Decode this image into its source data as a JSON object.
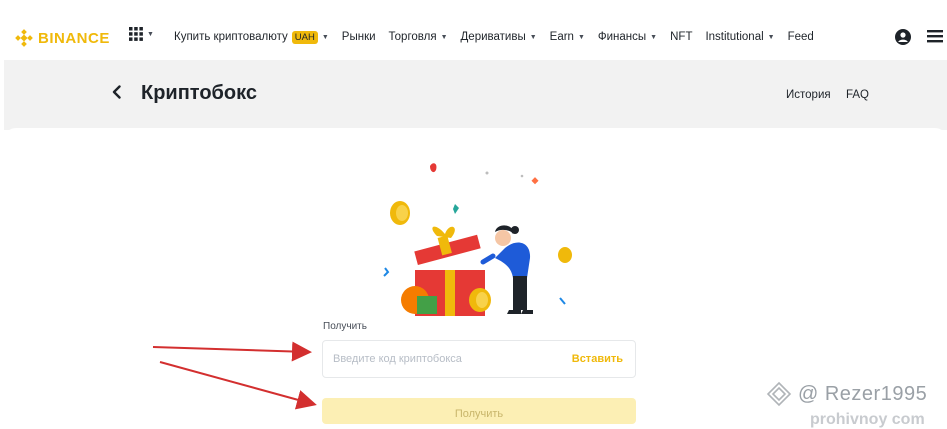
{
  "nav": {
    "brand": "BINANCE",
    "items": [
      {
        "label": "Купить криптовалюту",
        "badge": "UAH",
        "caret": true
      },
      {
        "label": "Рынки",
        "caret": false
      },
      {
        "label": "Торговля",
        "caret": true
      },
      {
        "label": "Деривативы",
        "caret": true
      },
      {
        "label": "Earn",
        "caret": true
      },
      {
        "label": "Финансы",
        "caret": true
      },
      {
        "label": "NFT",
        "caret": false
      },
      {
        "label": "Institutional",
        "caret": true
      },
      {
        "label": "Feed",
        "caret": false
      }
    ],
    "caret_glyph": "▼"
  },
  "header": {
    "title": "Криптобокс",
    "history": "История",
    "faq": "FAQ"
  },
  "form": {
    "label": "Получить",
    "input_placeholder": "Введите код криптобокса",
    "paste": "Вставить",
    "submit": "Получить"
  },
  "watermark": {
    "handle": "@ Rezer1995",
    "site": "prohivnoy com"
  },
  "colors": {
    "brand": "#f0b90b",
    "annotation_arrow": "#d32f2f"
  },
  "icons": [
    "binance-logo-icon",
    "apps-grid-icon",
    "user-icon",
    "menu-icon",
    "back-arrow-icon",
    "gift-illustration"
  ]
}
